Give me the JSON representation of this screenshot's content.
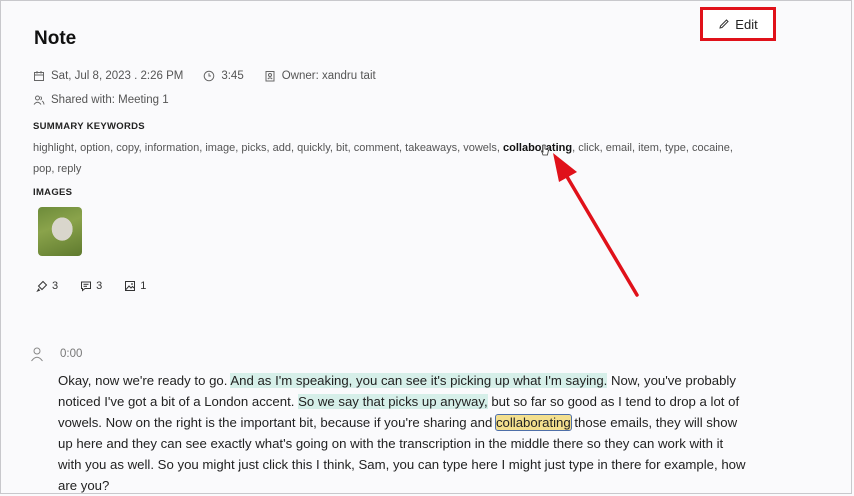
{
  "note": {
    "title": "Note",
    "edit_label": "Edit"
  },
  "meta": {
    "date": "Sat, Jul 8, 2023 . 2:26 PM",
    "duration": "3:45",
    "owner": "Owner: xandru tait",
    "shared": "Shared with: Meeting 1"
  },
  "summary": {
    "label": "SUMMARY KEYWORDS",
    "keywords": [
      "highlight",
      "option",
      "copy",
      "information",
      "image",
      "picks",
      "add",
      "quickly",
      "bit",
      "comment",
      "takeaways",
      "vowels",
      "collaborating",
      "click",
      "email",
      "item",
      "type",
      "cocaine",
      "pop",
      "reply"
    ],
    "active_keyword": "collaborating"
  },
  "images": {
    "label": "IMAGES"
  },
  "stats": {
    "highlights": "3",
    "comments": "3",
    "images": "1"
  },
  "transcript": {
    "timestamp": "0:00",
    "p1": "Okay, now we're ready to go. ",
    "h1": "And as I'm speaking, you can see it's picking up what I'm saying.",
    "p2": " Now, you've probably noticed I've got a bit of a London accent. ",
    "h2": "So we say that picks up anyway,",
    "p3": " but so far so good as I tend to drop a lot of vowels. Now on the right is the important bit, because if you're sharing and ",
    "hw": "collaborating",
    "p4": " those emails, they will show up here and they can see exactly what's going on with the transcription in the middle there so they can work with it with you as well. So you might just click this I think, Sam, you can type here I might just type in there for example, how are you?"
  },
  "colors": {
    "annotation": "#e0111a",
    "highlight": "#d6efe9",
    "word_highlight": "#f3df8e"
  }
}
